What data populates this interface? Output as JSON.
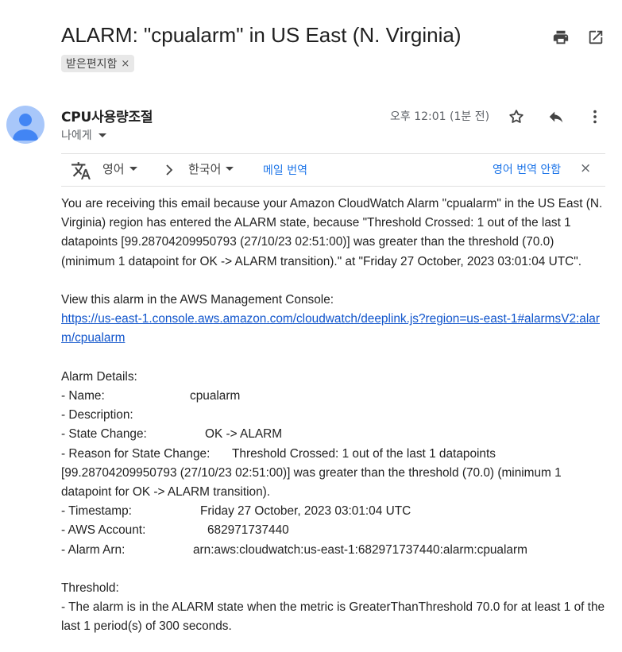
{
  "subject": "ALARM: \"cpualarm\" in US East (N. Virginia)",
  "label": "받은편지함",
  "label_remove": "×",
  "sender": {
    "name": "CPU사용량조절",
    "to": "나에게"
  },
  "time": "오후 12:01 (1분 전)",
  "icons": {
    "print": "printer-icon",
    "open_new": "open-in-new-window-icon",
    "star": "star-icon",
    "reply": "reply-icon",
    "more": "more-vertical-icon",
    "translate": "translate-icon"
  },
  "translate_bar": {
    "source_lang": "영어",
    "target_lang": "한국어",
    "translate_msg": "메일 번역",
    "dont_translate": "영어 번역 안함",
    "close": "×"
  },
  "body": {
    "intro": "You are receiving this email because your Amazon CloudWatch Alarm \"cpualarm\" in the US East (N. Virginia) region has entered the ALARM state, because \"Threshold Crossed: 1 out of the last 1 datapoints [99.28704209950793 (27/10/23 02:51:00)] was greater than the threshold (70.0) (minimum 1 datapoint for OK -> ALARM transition).\" at \"Friday 27 October, 2023 03:01:04 UTC\".",
    "view_text": "View this alarm in the AWS Management Console:",
    "console_link": "https://us-east-1.console.aws.amazon.com/cloudwatch/deeplink.js?region=us-east-1#alarmsV2:alarm/cpualarm",
    "details_heading": "Alarm Details:",
    "details": {
      "name_key": "- Name:",
      "name_val": "cpualarm",
      "desc_key": "- Description:",
      "state_key": "- State Change:",
      "state_val": "OK -> ALARM",
      "reason_key": "- Reason for State Change:",
      "reason_val": "Threshold Crossed: 1 out of the last 1 datapoints [99.28704209950793 (27/10/23 02:51:00)] was greater than the threshold (70.0) (minimum 1 datapoint for OK -> ALARM transition).",
      "ts_key": "- Timestamp:",
      "ts_val": "Friday 27 October, 2023 03:01:04 UTC",
      "acct_key": "- AWS Account:",
      "acct_val": "682971737440",
      "arn_key": "- Alarm Arn:",
      "arn_val": "arn:aws:cloudwatch:us-east-1:682971737440:alarm:cpualarm"
    },
    "threshold_heading": "Threshold:",
    "threshold_text": "- The alarm is in the ALARM state when the metric is GreaterThanThreshold 70.0 for at least 1 of the last 1 period(s) of 300 seconds."
  }
}
